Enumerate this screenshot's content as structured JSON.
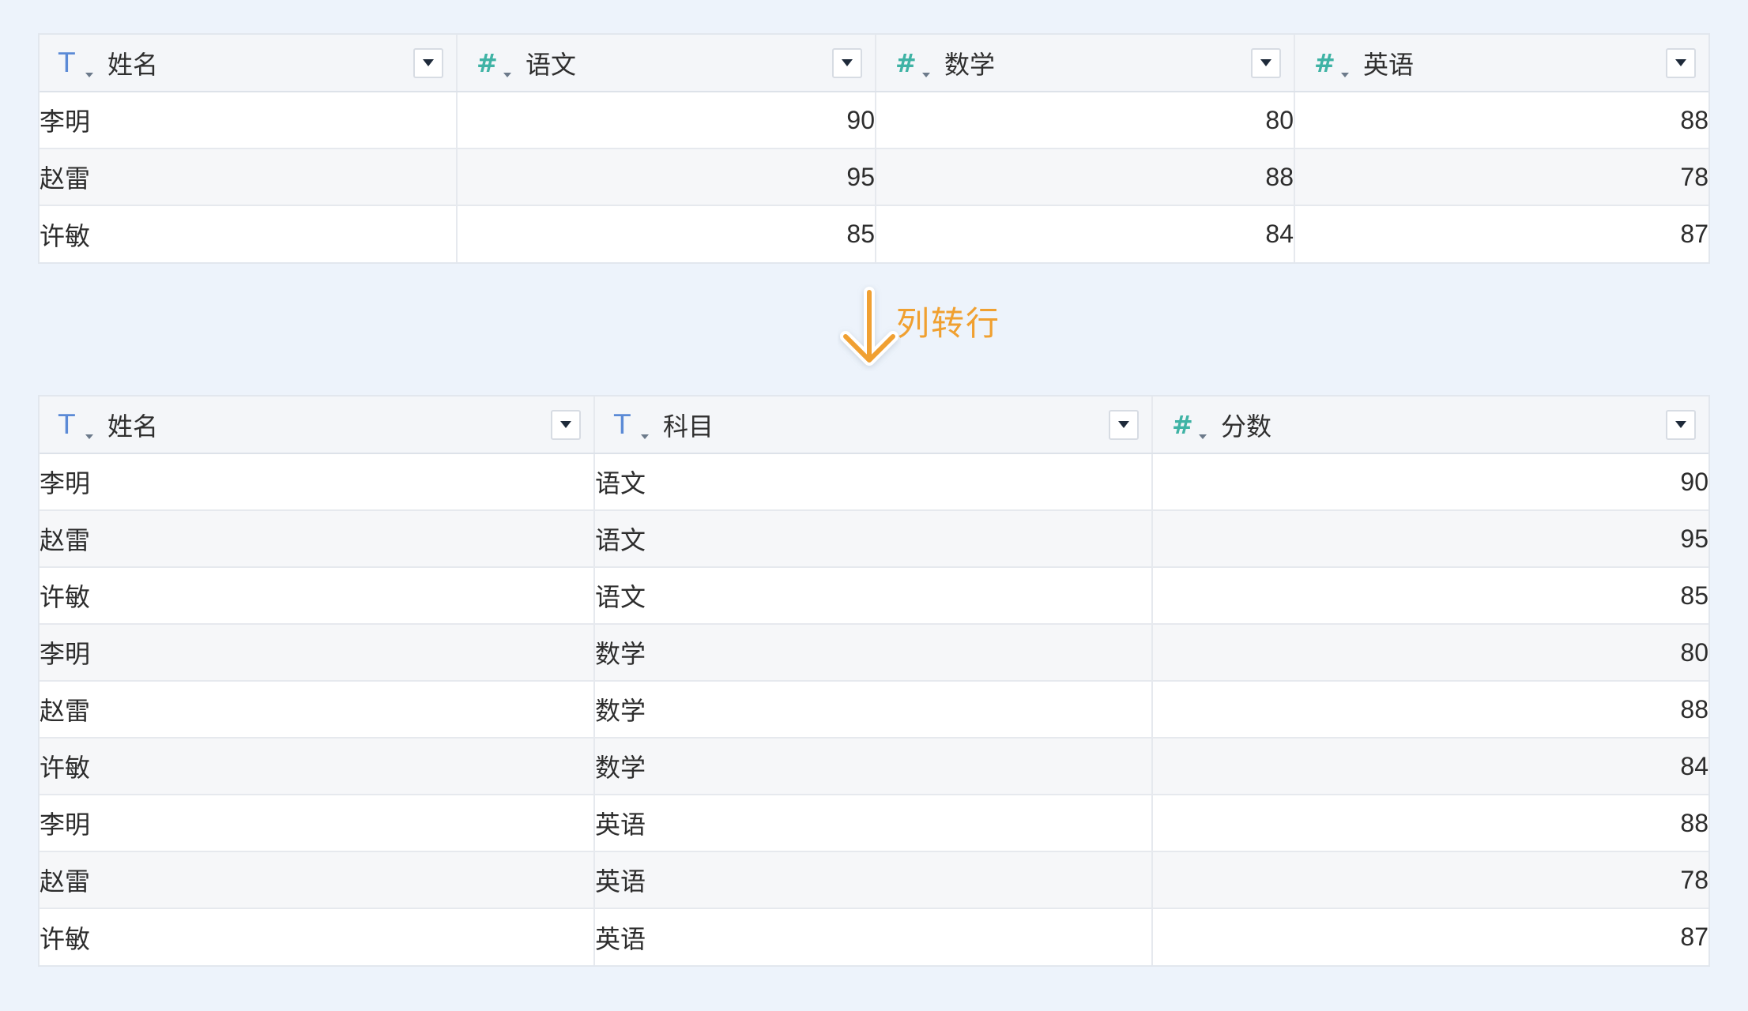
{
  "top_table": {
    "columns": [
      {
        "type": "text",
        "label": "姓名"
      },
      {
        "type": "number",
        "label": "语文"
      },
      {
        "type": "number",
        "label": "数学"
      },
      {
        "type": "number",
        "label": "英语"
      }
    ],
    "rows": [
      [
        "李明",
        "90",
        "80",
        "88"
      ],
      [
        "赵雷",
        "95",
        "88",
        "78"
      ],
      [
        "许敏",
        "85",
        "84",
        "87"
      ]
    ]
  },
  "transform": {
    "label": "列转行",
    "icon": "arrow-down-icon",
    "color": "#f0a030"
  },
  "bottom_table": {
    "columns": [
      {
        "type": "text",
        "label": "姓名"
      },
      {
        "type": "text",
        "label": "科目"
      },
      {
        "type": "number",
        "label": "分数"
      }
    ],
    "rows": [
      [
        "李明",
        "语文",
        "90"
      ],
      [
        "赵雷",
        "语文",
        "95"
      ],
      [
        "许敏",
        "语文",
        "85"
      ],
      [
        "李明",
        "数学",
        "80"
      ],
      [
        "赵雷",
        "数学",
        "88"
      ],
      [
        "许敏",
        "数学",
        "84"
      ],
      [
        "李明",
        "英语",
        "88"
      ],
      [
        "赵雷",
        "英语",
        "78"
      ],
      [
        "许敏",
        "英语",
        "87"
      ]
    ]
  },
  "icons": {
    "text_type": "text-type-icon",
    "number_type": "number-type-icon",
    "dropdown": "dropdown-icon"
  },
  "colors": {
    "background": "#edf3fb",
    "text_type_icon": "#5b8ad6",
    "number_type_icon": "#3fb3a5"
  }
}
